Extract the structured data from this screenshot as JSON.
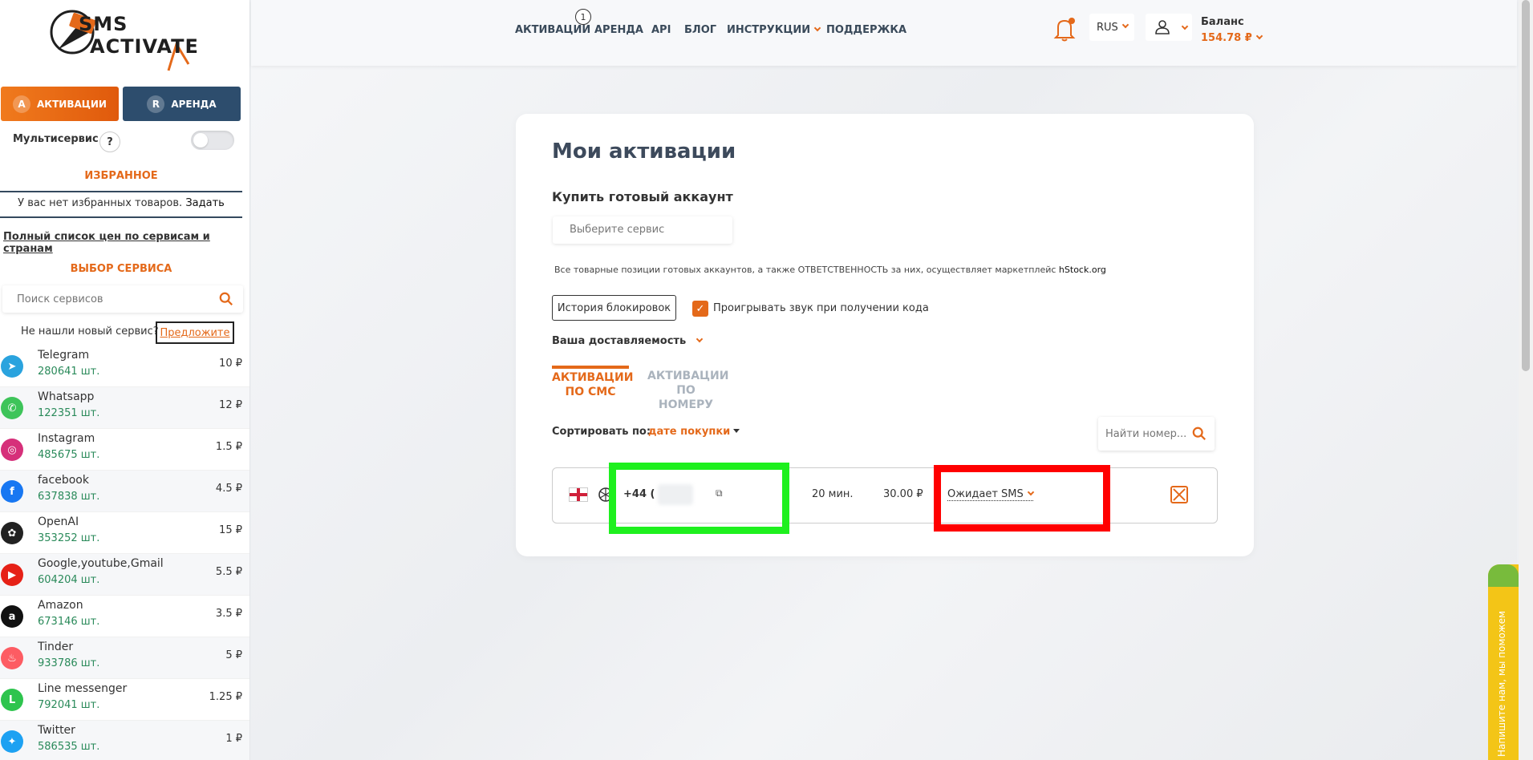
{
  "logo": {
    "line1": "SMS",
    "line2": "ACTIVATE"
  },
  "sidebar": {
    "btn_activations": "Активации",
    "btn_rent": "Аренда",
    "multiservice_label": "Мультисервис",
    "help_symbol": "?",
    "favorites_title": "Избранное",
    "favorites_empty": "У вас нет избранных товаров.",
    "favorites_set": "Задать",
    "price_list_link": "Полный список цен по сервисам и странам",
    "service_select_title": "Выбор сервиса",
    "search_placeholder": "Поиск сервисов",
    "not_found_text": "Не нашли новый сервис?",
    "suggest_btn": "Предложите",
    "services": [
      {
        "name": "Telegram",
        "count": "280641 шт.",
        "price": "10 ₽",
        "icon": "telegram-icon",
        "color": "#2aa3de",
        "glyph": "➤"
      },
      {
        "name": "Whatsapp",
        "count": "122351 шт.",
        "price": "12 ₽",
        "icon": "whatsapp-icon",
        "color": "#3ec45a",
        "glyph": "✆"
      },
      {
        "name": "Instagram",
        "count": "485675 шт.",
        "price": "1.5 ₽",
        "icon": "instagram-icon",
        "color": "#d6307a",
        "glyph": "◎"
      },
      {
        "name": "facebook",
        "count": "637838 шт.",
        "price": "4.5 ₽",
        "icon": "facebook-icon",
        "color": "#1877f2",
        "glyph": "f"
      },
      {
        "name": "OpenAI",
        "count": "353252 шт.",
        "price": "15 ₽",
        "icon": "openai-icon",
        "color": "#222222",
        "glyph": "✿"
      },
      {
        "name": "Google,youtube,Gmail",
        "count": "604204 шт.",
        "price": "5.5 ₽",
        "icon": "youtube-icon",
        "color": "#e62117",
        "glyph": "▶"
      },
      {
        "name": "Amazon",
        "count": "673146 шт.",
        "price": "3.5 ₽",
        "icon": "amazon-icon",
        "color": "#111111",
        "glyph": "a"
      },
      {
        "name": "Tinder",
        "count": "933786 шт.",
        "price": "5 ₽",
        "icon": "tinder-icon",
        "color": "#fd5c63",
        "glyph": "♨"
      },
      {
        "name": "Line messenger",
        "count": "792041 шт.",
        "price": "1.25 ₽",
        "icon": "line-icon",
        "color": "#2ec44e",
        "glyph": "L"
      },
      {
        "name": "Twitter",
        "count": "586535 шт.",
        "price": "1 ₽",
        "icon": "twitter-icon",
        "color": "#1da1f2",
        "glyph": "✦"
      }
    ]
  },
  "nav": {
    "items": [
      "Активации",
      "Аренда",
      "API",
      "Блог",
      "Инструкции",
      "Поддержка"
    ],
    "badge": "1",
    "lang": "RUS",
    "balance_label": "Баланс",
    "balance_value": "154.78 ₽"
  },
  "main": {
    "title": "Мои активации",
    "buy_title": "Купить готовый аккаунт",
    "service_placeholder": "Выберите сервис",
    "disclaimer": "Все товарные позиции готовых аккаунтов, а также ОТВЕТСТВЕННОСТЬ за них, осуществляет маркетплейс",
    "disclaimer_brand": "hStock.org",
    "history_btn": "История блокировок",
    "sound_label": "Проигрывать звук при получении кода",
    "delivery_label": "Ваша доставляемость",
    "tab_sms_line1": "Активации",
    "tab_sms_line2": "по СМС",
    "tab_number_line1": "Активации",
    "tab_number_line2": "по номеру",
    "sort_label": "Сортировать по:",
    "sort_value": "дате покупки",
    "find_placeholder": "Найти номер...",
    "activation": {
      "phone_prefix": "+44 (",
      "time": "20 мин.",
      "price": "30.00 ₽",
      "status": "Ожидает SMS"
    }
  },
  "help_tab": "Напишите нам, мы поможем",
  "colors": {
    "accent": "#e4691a",
    "navy": "#2d4d6d",
    "highlight_green": "#1ef01e",
    "highlight_red": "#ff0000"
  }
}
